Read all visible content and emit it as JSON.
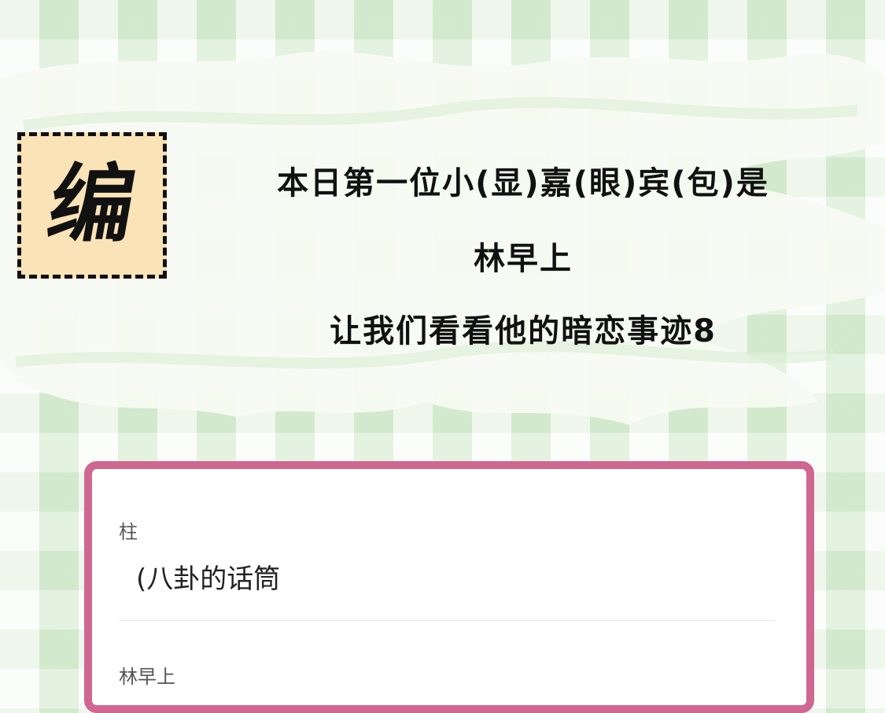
{
  "badge": {
    "char": "编"
  },
  "headline": {
    "line1": "本日第一位小(显)嘉(眼)宾(包)是",
    "line2": "林早上",
    "line3": "让我们看看他的暗恋事迹8"
  },
  "chat": {
    "messages": [
      {
        "speaker": "柱",
        "text": "(八卦的话筒"
      },
      {
        "speaker": "林早上",
        "text": ""
      }
    ]
  },
  "colors": {
    "card_border": "#cf6791",
    "badge_fill": "#fbe3b8",
    "background": "#eaf5e6"
  }
}
